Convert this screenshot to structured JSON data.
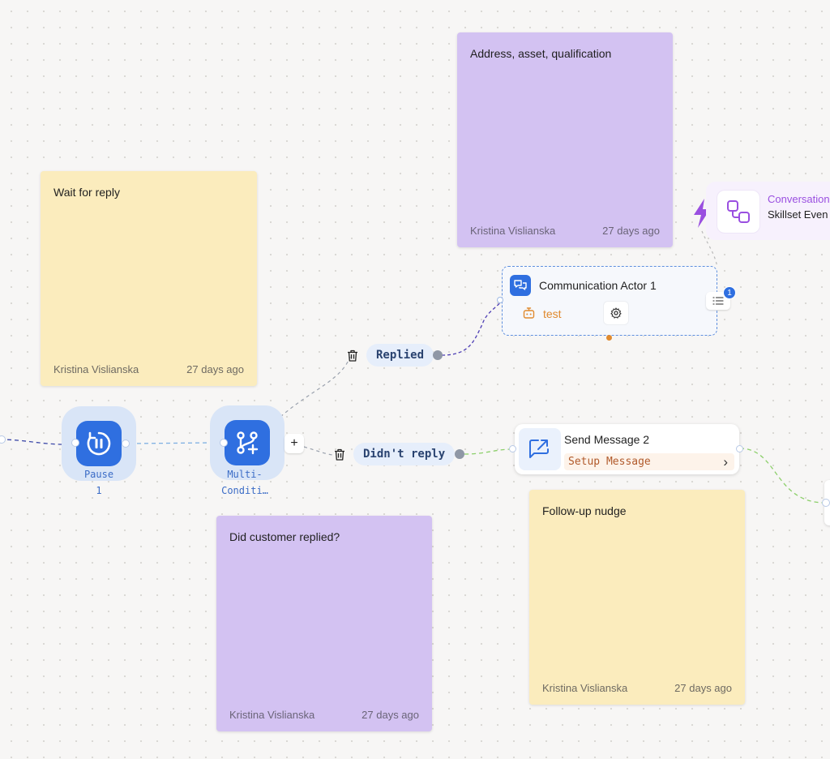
{
  "notes": {
    "wait": {
      "text": "Wait for reply",
      "author": "Kristina Vislianska",
      "time": "27 days ago"
    },
    "address": {
      "text": "Address, asset, qualification",
      "author": "Kristina Vislianska",
      "time": "27 days ago"
    },
    "customer": {
      "text": "Did customer replied?",
      "author": "Kristina Vislianska",
      "time": "27 days ago"
    },
    "followup": {
      "text": "Follow-up nudge",
      "author": "Kristina Vislianska",
      "time": "27 days ago"
    }
  },
  "nodes": {
    "pause": {
      "label_line1": "Pause",
      "label_line2": "1",
      "icon": "pause-icon"
    },
    "multi": {
      "label_line1": "Multi-",
      "label_line2": "Conditi…",
      "icon": "branch-icon"
    }
  },
  "branches": {
    "replied": "Replied",
    "didnt_reply": "Didn't reply",
    "add_symbol": "+"
  },
  "actor": {
    "title": "Communication Actor 1",
    "agent": "test",
    "badge_count": "1"
  },
  "send_message": {
    "title": "Send Message 2",
    "setup": "Setup Message",
    "chevron": "›"
  },
  "trigger": {
    "category": "Conversation",
    "name": "Skillset Even"
  },
  "colors": {
    "accent_blue": "#2f6fe0",
    "sticky_yellow": "#fbecbd",
    "sticky_purple": "#d3c2f2",
    "agent_orange": "#e08a2e",
    "trigger_purple": "#9a4fe0"
  }
}
